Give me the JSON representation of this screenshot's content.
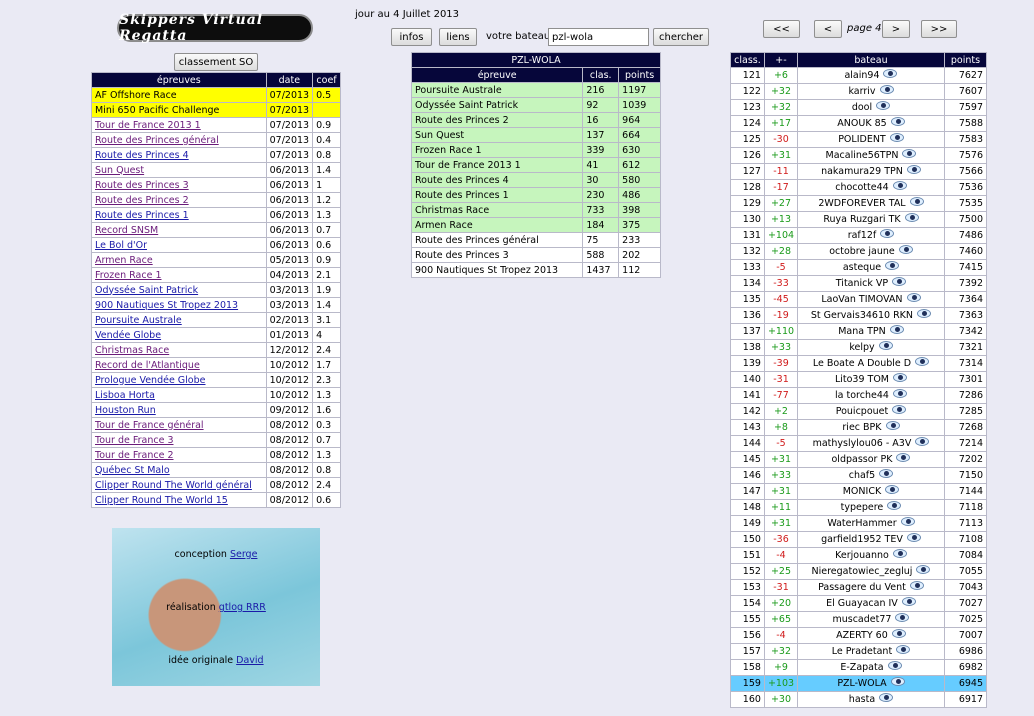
{
  "logo": "Skippers Virtual Regatta",
  "date_text": "jour au 4 Juillet 2013",
  "toolbar": {
    "infos": "infos",
    "liens": "liens",
    "boat_label": "votre bateau",
    "boat_value": "pzl-wola",
    "search": "chercher"
  },
  "pager": {
    "first": "<<",
    "prev": "<",
    "page": "page 4",
    "next": ">",
    "last": ">>"
  },
  "classement_button": "classement SO",
  "epreuves": {
    "headers": [
      "épreuves",
      "date",
      "coef"
    ],
    "rows": [
      {
        "name": "AF Offshore Race",
        "date": "07/2013",
        "coef": "0.5",
        "style": "yellow"
      },
      {
        "name": "Mini 650 Pacific Challenge",
        "date": "07/2013",
        "coef": "",
        "style": "yellow"
      },
      {
        "name": "Tour de France 2013 1",
        "date": "07/2013",
        "coef": "0.9",
        "style": "visited"
      },
      {
        "name": "Route des Princes général",
        "date": "07/2013",
        "coef": "0.4",
        "style": "visited"
      },
      {
        "name": "Route des Princes 4",
        "date": "07/2013",
        "coef": "0.8",
        "style": "link"
      },
      {
        "name": "Sun Quest",
        "date": "06/2013",
        "coef": "1.4",
        "style": "visited"
      },
      {
        "name": "Route des Princes 3",
        "date": "06/2013",
        "coef": "1",
        "style": "visited"
      },
      {
        "name": "Route des Princes 2",
        "date": "06/2013",
        "coef": "1.2",
        "style": "visited"
      },
      {
        "name": "Route des Princes 1",
        "date": "06/2013",
        "coef": "1.3",
        "style": "link"
      },
      {
        "name": "Record SNSM",
        "date": "06/2013",
        "coef": "0.7",
        "style": "visited"
      },
      {
        "name": "Le Bol d'Or",
        "date": "06/2013",
        "coef": "0.6",
        "style": "link"
      },
      {
        "name": "Armen Race",
        "date": "05/2013",
        "coef": "0.9",
        "style": "visited"
      },
      {
        "name": "Frozen Race 1",
        "date": "04/2013",
        "coef": "2.1",
        "style": "visited"
      },
      {
        "name": "Odyssée Saint Patrick",
        "date": "03/2013",
        "coef": "1.9",
        "style": "link"
      },
      {
        "name": "900 Nautiques St Tropez 2013",
        "date": "03/2013",
        "coef": "1.4",
        "style": "link"
      },
      {
        "name": "Poursuite Australe",
        "date": "02/2013",
        "coef": "3.1",
        "style": "link"
      },
      {
        "name": "Vendée Globe",
        "date": "01/2013",
        "coef": "4",
        "style": "link"
      },
      {
        "name": "Christmas Race",
        "date": "12/2012",
        "coef": "2.4",
        "style": "visited"
      },
      {
        "name": "Record de l'Atlantique",
        "date": "10/2012",
        "coef": "1.7",
        "style": "visited"
      },
      {
        "name": "Prologue Vendée Globe",
        "date": "10/2012",
        "coef": "2.3",
        "style": "link"
      },
      {
        "name": "Lisboa Horta",
        "date": "10/2012",
        "coef": "1.3",
        "style": "link"
      },
      {
        "name": "Houston Run",
        "date": "09/2012",
        "coef": "1.6",
        "style": "link"
      },
      {
        "name": "Tour de France général",
        "date": "08/2012",
        "coef": "0.3",
        "style": "visited"
      },
      {
        "name": "Tour de France 3",
        "date": "08/2012",
        "coef": "0.7",
        "style": "visited"
      },
      {
        "name": "Tour de France 2",
        "date": "08/2012",
        "coef": "1.3",
        "style": "visited"
      },
      {
        "name": "Québec St Malo",
        "date": "08/2012",
        "coef": "0.8",
        "style": "link"
      },
      {
        "name": "Clipper Round The World général",
        "date": "08/2012",
        "coef": "2.4",
        "style": "link"
      },
      {
        "name": "Clipper Round The World 15",
        "date": "08/2012",
        "coef": "0.6",
        "style": "link"
      }
    ]
  },
  "boat": {
    "name": "PZL-WOLA",
    "headers": [
      "épreuve",
      "clas.",
      "points"
    ],
    "rows": [
      {
        "name": "Poursuite Australe",
        "clas": "216",
        "points": "1197",
        "green": true
      },
      {
        "name": "Odyssée Saint Patrick",
        "clas": "92",
        "points": "1039",
        "green": true
      },
      {
        "name": "Route des Princes 2",
        "clas": "16",
        "points": "964",
        "green": true
      },
      {
        "name": "Sun Quest",
        "clas": "137",
        "points": "664",
        "green": true
      },
      {
        "name": "Frozen Race 1",
        "clas": "339",
        "points": "630",
        "green": true
      },
      {
        "name": "Tour de France 2013 1",
        "clas": "41",
        "points": "612",
        "green": true
      },
      {
        "name": "Route des Princes 4",
        "clas": "30",
        "points": "580",
        "green": true
      },
      {
        "name": "Route des Princes 1",
        "clas": "230",
        "points": "486",
        "green": true
      },
      {
        "name": "Christmas Race",
        "clas": "733",
        "points": "398",
        "green": true
      },
      {
        "name": "Armen Race",
        "clas": "184",
        "points": "375",
        "green": true
      },
      {
        "name": "Route des Princes général",
        "clas": "75",
        "points": "233",
        "green": false
      },
      {
        "name": "Route des Princes 3",
        "clas": "588",
        "points": "202",
        "green": false
      },
      {
        "name": "900 Nautiques St Tropez 2013",
        "clas": "1437",
        "points": "112",
        "green": false
      }
    ]
  },
  "ranking": {
    "headers": [
      "class.",
      "+-",
      "bateau",
      "points"
    ],
    "rows": [
      {
        "rank": "121",
        "delta": "+6",
        "boat": "alain94",
        "points": "7627"
      },
      {
        "rank": "122",
        "delta": "+32",
        "boat": "karriv",
        "points": "7607"
      },
      {
        "rank": "123",
        "delta": "+32",
        "boat": "dool",
        "points": "7597"
      },
      {
        "rank": "124",
        "delta": "+17",
        "boat": "ANOUK 85",
        "points": "7588"
      },
      {
        "rank": "125",
        "delta": "-30",
        "boat": "POLIDENT",
        "points": "7583"
      },
      {
        "rank": "126",
        "delta": "+31",
        "boat": "Macaline56TPN",
        "points": "7576"
      },
      {
        "rank": "127",
        "delta": "-11",
        "boat": "nakamura29 TPN",
        "points": "7566"
      },
      {
        "rank": "128",
        "delta": "-17",
        "boat": "chocotte44",
        "points": "7536"
      },
      {
        "rank": "129",
        "delta": "+27",
        "boat": "2WDFOREVER TAL",
        "points": "7535"
      },
      {
        "rank": "130",
        "delta": "+13",
        "boat": "Ruya Ruzgari TK",
        "points": "7500"
      },
      {
        "rank": "131",
        "delta": "+104",
        "boat": "raf12f",
        "points": "7486"
      },
      {
        "rank": "132",
        "delta": "+28",
        "boat": "octobre jaune",
        "points": "7460"
      },
      {
        "rank": "133",
        "delta": "-5",
        "boat": "asteque",
        "points": "7415"
      },
      {
        "rank": "134",
        "delta": "-33",
        "boat": "Titanick VP",
        "points": "7392"
      },
      {
        "rank": "135",
        "delta": "-45",
        "boat": "LaoVan TIMOVAN",
        "points": "7364"
      },
      {
        "rank": "136",
        "delta": "-19",
        "boat": "St Gervais34610 RKN",
        "points": "7363"
      },
      {
        "rank": "137",
        "delta": "+110",
        "boat": "Mana TPN",
        "points": "7342"
      },
      {
        "rank": "138",
        "delta": "+33",
        "boat": "kelpy",
        "points": "7321"
      },
      {
        "rank": "139",
        "delta": "-39",
        "boat": "Le Boate A Double D",
        "points": "7314"
      },
      {
        "rank": "140",
        "delta": "-31",
        "boat": "Lito39 TOM",
        "points": "7301"
      },
      {
        "rank": "141",
        "delta": "-77",
        "boat": "la torche44",
        "points": "7286"
      },
      {
        "rank": "142",
        "delta": "+2",
        "boat": "Pouicpouet",
        "points": "7285"
      },
      {
        "rank": "143",
        "delta": "+8",
        "boat": "riec BPK",
        "points": "7268"
      },
      {
        "rank": "144",
        "delta": "-5",
        "boat": "mathyslylou06 - A3V",
        "points": "7214"
      },
      {
        "rank": "145",
        "delta": "+31",
        "boat": "oldpassor PK",
        "points": "7202"
      },
      {
        "rank": "146",
        "delta": "+33",
        "boat": "chaf5",
        "points": "7150"
      },
      {
        "rank": "147",
        "delta": "+31",
        "boat": "MONICK",
        "points": "7144"
      },
      {
        "rank": "148",
        "delta": "+11",
        "boat": "typepere",
        "points": "7118"
      },
      {
        "rank": "149",
        "delta": "+31",
        "boat": "WaterHammer",
        "points": "7113"
      },
      {
        "rank": "150",
        "delta": "-36",
        "boat": "garfield1952 TEV",
        "points": "7108"
      },
      {
        "rank": "151",
        "delta": "-4",
        "boat": "Kerjouanno",
        "points": "7084"
      },
      {
        "rank": "152",
        "delta": "+25",
        "boat": "Nieregatowiec_zegluj",
        "points": "7055"
      },
      {
        "rank": "153",
        "delta": "-31",
        "boat": "Passagere du Vent",
        "points": "7043"
      },
      {
        "rank": "154",
        "delta": "+20",
        "boat": "El Guayacan IV",
        "points": "7027"
      },
      {
        "rank": "155",
        "delta": "+65",
        "boat": "muscadet77",
        "points": "7025"
      },
      {
        "rank": "156",
        "delta": "-4",
        "boat": "AZERTY 60",
        "points": "7007"
      },
      {
        "rank": "157",
        "delta": "+32",
        "boat": "Le Pradetant",
        "points": "6986"
      },
      {
        "rank": "158",
        "delta": "+9",
        "boat": "E-Zapata",
        "points": "6982"
      },
      {
        "rank": "159",
        "delta": "+103",
        "boat": "PZL-WOLA",
        "points": "6945",
        "me": true
      },
      {
        "rank": "160",
        "delta": "+30",
        "boat": "hasta",
        "points": "6917"
      }
    ]
  },
  "credits": {
    "conception_label": "conception",
    "conception_name": "Serge",
    "realisation_label": "réalisation",
    "realisation_name": "gtlog RRR",
    "idee_label": "idée originale",
    "idee_name": "David"
  },
  "colors": {
    "header": "#06063a",
    "highlight_yellow": "#ffff00",
    "highlight_green": "#c6f5bd",
    "own_row": "#66ccff",
    "positive": "#1a9a1a",
    "negative": "#d01a1a"
  }
}
